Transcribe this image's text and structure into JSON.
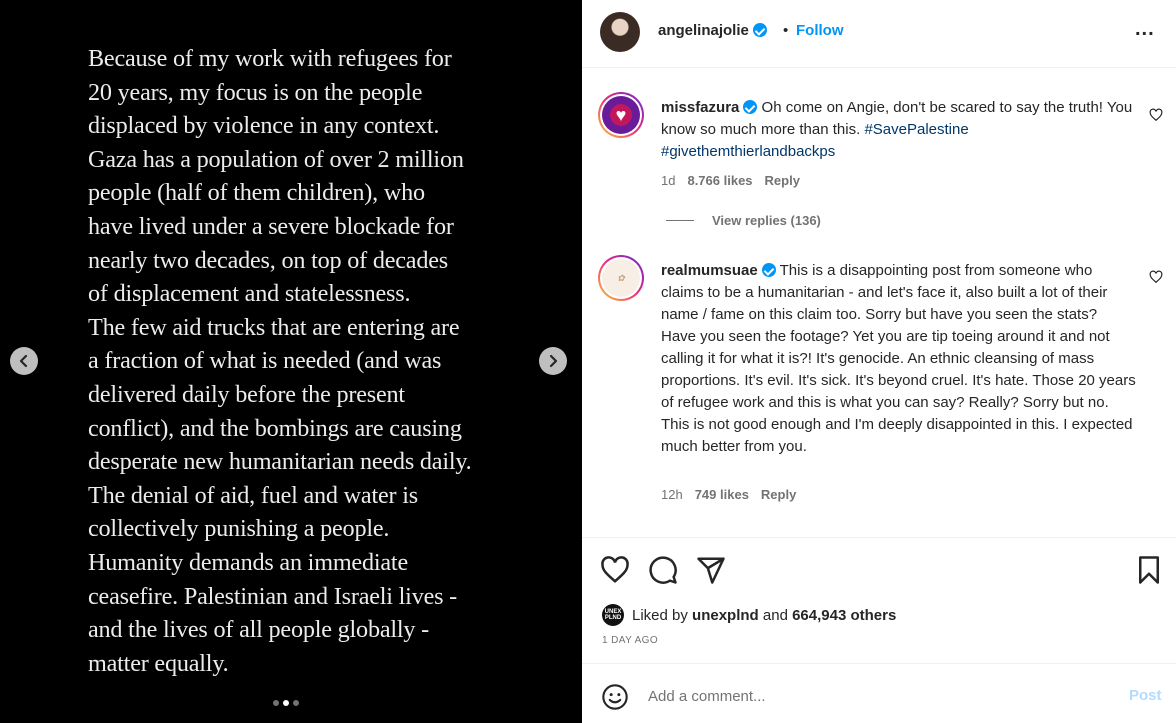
{
  "media": {
    "text": "Because of my work with refugees for\n20 years, my focus is on the people\ndisplaced by violence in any context.\nGaza has a population of over 2 million\npeople (half of them children), who\nhave lived under a severe blockade for\nnearly two decades, on top of decades\nof displacement and statelessness.\nThe few aid trucks that are entering are\na fraction of what is needed (and was\ndelivered daily before the present\nconflict), and the bombings are causing\ndesperate new humanitarian needs daily.\nThe denial of aid, fuel and water is\ncollectively punishing a people.\nHumanity demands an immediate\nceasefire. Palestinian and Israeli lives -\nand the lives of all people globally -\nmatter equally.",
    "carousel_index": 2,
    "carousel_count": 3
  },
  "header": {
    "username": "angelinajolie",
    "separator": "•",
    "follow_label": "Follow",
    "more_label": "..."
  },
  "comments": [
    {
      "username": "missfazura",
      "text": "Oh come on Angie, don't be scared to say the truth! You know so much more than this.",
      "hashtags": "#SavePalestine #givethemthierlandbackps",
      "time": "1d",
      "likes": "8.766 likes",
      "reply_label": "Reply",
      "view_replies": "View replies (136)"
    },
    {
      "username": "realmumsuae",
      "text": "This is a disappointing post from someone who claims to be a humanitarian - and let's face it, also built a lot of their name / fame on this claim too. Sorry but have you seen the stats? Have you seen the footage? Yet you are tip toeing around it and not calling it for what it is?! It's genocide. An ethnic cleansing of mass proportions. It's evil. It's sick. It's beyond cruel. It's hate. Those 20 years of refugee work and this is what you can say? Really? Sorry but no. This is not good enough and I'm deeply disappointed in this. I expected much better from you.",
      "time": "12h",
      "likes": "749 likes",
      "reply_label": "Reply"
    }
  ],
  "actions": {
    "liked_prefix": "Liked by",
    "liked_user": "unexplnd",
    "liked_and": "and",
    "liked_others": "664,943 others",
    "liked_avatar_text": "UNEX PLND",
    "time_ago": "1 DAY AGO"
  },
  "add_comment": {
    "placeholder": "Add a comment...",
    "post_label": "Post"
  },
  "icons": [
    "chevron-left-icon",
    "chevron-right-icon",
    "verified-icon",
    "heart-icon",
    "comment-icon",
    "share-icon",
    "bookmark-icon",
    "emoji-icon"
  ],
  "colors": {
    "accent": "#0095f6",
    "hashtag": "#00376b",
    "muted": "#737373"
  }
}
